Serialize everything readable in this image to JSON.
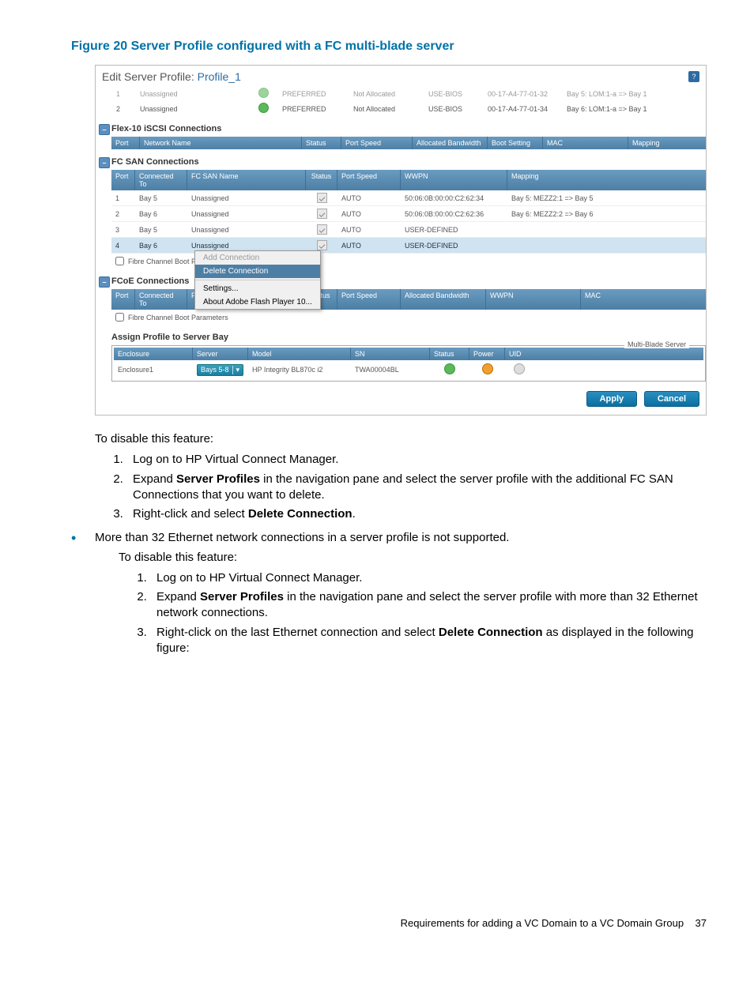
{
  "figure_title": "Figure 20 Server Profile configured with a FC multi-blade server",
  "panel": {
    "title_prefix": "Edit Server Profile:",
    "profile_name": "Profile_1",
    "eth_rows": [
      {
        "port": "1",
        "name": "Unassigned",
        "speed": "PREFERRED",
        "alloc": "Not Allocated",
        "boot": "USE-BIOS",
        "mac": "00-17-A4-77-01-32",
        "mapping": "Bay 5: LOM:1-a => Bay 1"
      },
      {
        "port": "2",
        "name": "Unassigned",
        "speed": "PREFERRED",
        "alloc": "Not Allocated",
        "boot": "USE-BIOS",
        "mac": "00-17-A4-77-01-34",
        "mapping": "Bay 6: LOM:1-a => Bay 1"
      }
    ],
    "iscsi": {
      "title": "Flex-10 iSCSI Connections",
      "headers": {
        "port": "Port",
        "netname": "Network Name",
        "status": "Status",
        "portspeed": "Port Speed",
        "allocbw": "Allocated Bandwidth",
        "boot": "Boot Setting",
        "mac": "MAC",
        "mapping": "Mapping"
      }
    },
    "fcsan": {
      "title": "FC SAN Connections",
      "headers": {
        "port": "Port",
        "connto": "Connected To",
        "fcname": "FC SAN Name",
        "status": "Status",
        "portspeed": "Port Speed",
        "wwpn": "WWPN",
        "mapping": "Mapping"
      },
      "rows": [
        {
          "port": "1",
          "connto": "Bay 5",
          "fcname": "Unassigned",
          "portspeed": "AUTO",
          "wwpn": "50:06:0B:00:00:C2:62:34",
          "mapping": "Bay 5: MEZZ2:1 => Bay 5"
        },
        {
          "port": "2",
          "connto": "Bay 6",
          "fcname": "Unassigned",
          "portspeed": "AUTO",
          "wwpn": "50:06:0B:00:00:C2:62:36",
          "mapping": "Bay 6: MEZZ2:2 => Bay 6"
        },
        {
          "port": "3",
          "connto": "Bay 5",
          "fcname": "Unassigned",
          "portspeed": "AUTO",
          "wwpn": "USER-DEFINED",
          "mapping": ""
        },
        {
          "port": "4",
          "connto": "Bay 6",
          "fcname": "Unassigned",
          "portspeed": "AUTO",
          "wwpn": "USER-DEFINED",
          "mapping": ""
        }
      ],
      "fc_boot_label": "Fibre Channel Boot Parameters"
    },
    "context_menu": {
      "add": "Add Connection",
      "delete": "Delete Connection",
      "settings": "Settings...",
      "about": "About Adobe Flash Player 10..."
    },
    "fcoe": {
      "title": "FCoE Connections",
      "headers": {
        "port": "Port",
        "connto": "Connected To",
        "fcname": "FC SAN Name",
        "status": "Status",
        "portspeed": "Port Speed",
        "allocbw": "Allocated Bandwidth",
        "wwpn": "WWPN",
        "mac": "MAC"
      },
      "fc_boot_label": "Fibre Channel Boot Parameters"
    },
    "assign": {
      "title": "Assign Profile to Server Bay",
      "headers": {
        "enc": "Enclosure",
        "svr": "Server",
        "mod": "Model",
        "sn": "SN",
        "st": "Status",
        "pw": "Power",
        "uid": "UID"
      },
      "legend": "Multi-Blade Server",
      "row": {
        "enc": "Enclosure1",
        "svr": "Bays 5-8",
        "mod": "HP Integrity BL870c i2",
        "sn": "TWA00004BL"
      }
    },
    "buttons": {
      "apply": "Apply",
      "cancel": "Cancel"
    }
  },
  "doc": {
    "p1": "To disable this feature:",
    "li1": "Log on to HP Virtual Connect Manager.",
    "li2a": "Expand ",
    "li2b": "Server Profiles",
    "li2c": " in the navigation pane and select the server profile with the additional FC SAN Connections that you want to delete.",
    "li3a": "Right-click and select ",
    "li3b": "Delete Connection",
    "li3c": ".",
    "bullet": "More than 32 Ethernet network connections in a server profile is not supported.",
    "p2": "To disable this feature:",
    "li4": "Log on to HP Virtual Connect Manager.",
    "li5a": "Expand ",
    "li5b": "Server Profiles",
    "li5c": " in the navigation pane and select the server profile with more than 32 Ethernet network connections.",
    "li6a": "Right-click on the last Ethernet connection and select ",
    "li6b": "Delete Connection",
    "li6c": " as displayed in the following figure:"
  },
  "footer": {
    "text": "Requirements for adding a VC Domain to a VC Domain Group",
    "page": "37"
  }
}
